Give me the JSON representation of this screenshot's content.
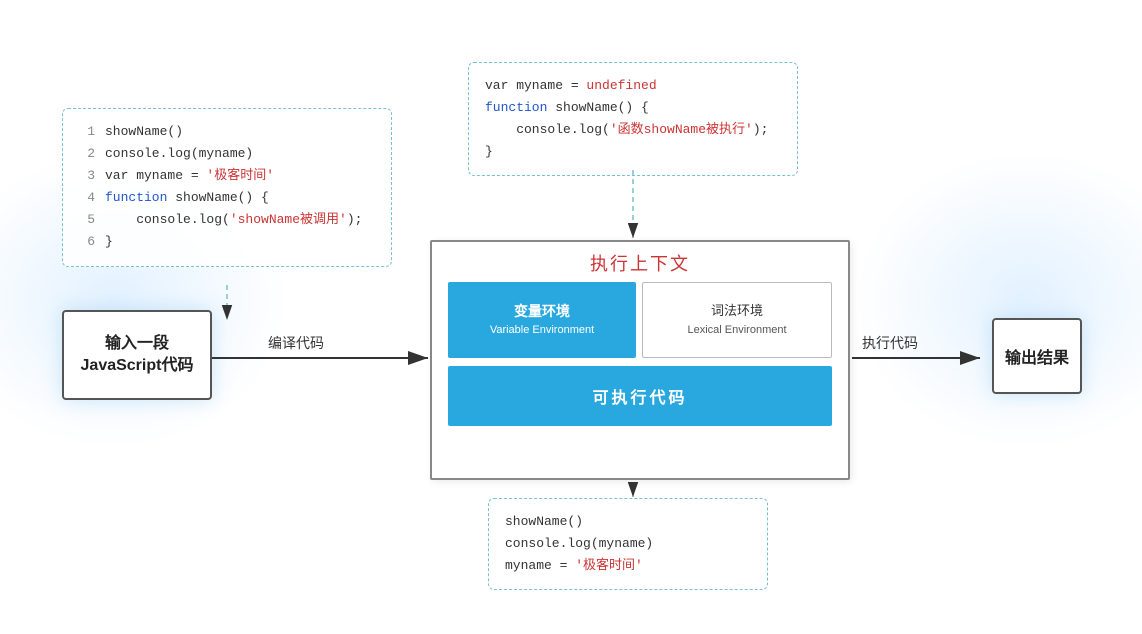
{
  "bg": {
    "glow_color": "rgba(173,216,255,0.35)"
  },
  "code_topleft": {
    "lines": [
      {
        "num": "1",
        "text": "showName()"
      },
      {
        "num": "2",
        "text": "console.log(myname)"
      },
      {
        "num": "3",
        "text": "var myname = '极客时间'"
      },
      {
        "num": "4",
        "text_parts": [
          {
            "t": "function ",
            "cls": "kw"
          },
          {
            "t": "showName",
            "cls": ""
          },
          {
            "t": "() {",
            "cls": ""
          }
        ]
      },
      {
        "num": "5",
        "text": "    console.log('showName被调用');"
      },
      {
        "num": "6",
        "text": "}"
      }
    ]
  },
  "code_topcenter": {
    "lines": [
      {
        "text_parts": [
          {
            "t": "var myname = ",
            "cls": ""
          },
          {
            "t": "undefined",
            "cls": "red"
          }
        ]
      },
      {
        "text_parts": [
          {
            "t": "function ",
            "cls": "kw"
          },
          {
            "t": "showName() {",
            "cls": ""
          }
        ]
      },
      {
        "text_parts": [
          {
            "t": "    console.log(",
            "cls": ""
          },
          {
            "t": "'函数showName被执行'",
            "cls": "str"
          },
          {
            "t": ");",
            "cls": ""
          }
        ]
      },
      {
        "text_parts": [
          {
            "t": "}",
            "cls": ""
          }
        ]
      }
    ]
  },
  "code_bottomcenter": {
    "lines": [
      {
        "text": "showName()"
      },
      {
        "text": "console.log(myname)"
      },
      {
        "text_parts": [
          {
            "t": "myname = ",
            "cls": ""
          },
          {
            "t": "'极客时间'",
            "cls": "str"
          }
        ]
      }
    ]
  },
  "input_box": {
    "line1": "输入一段",
    "line2": "JavaScript代码"
  },
  "exec_ctx": {
    "title": "执行上下文",
    "var_env_line1": "变量环境",
    "var_env_line2": "Variable Environment",
    "lex_env_line1": "词法环境",
    "lex_env_line2": "Lexical Environment",
    "exec_code": "可执行代码"
  },
  "output_box": {
    "label": "输出结果"
  },
  "label_compile": "编译代码",
  "label_execute": "执行代码"
}
